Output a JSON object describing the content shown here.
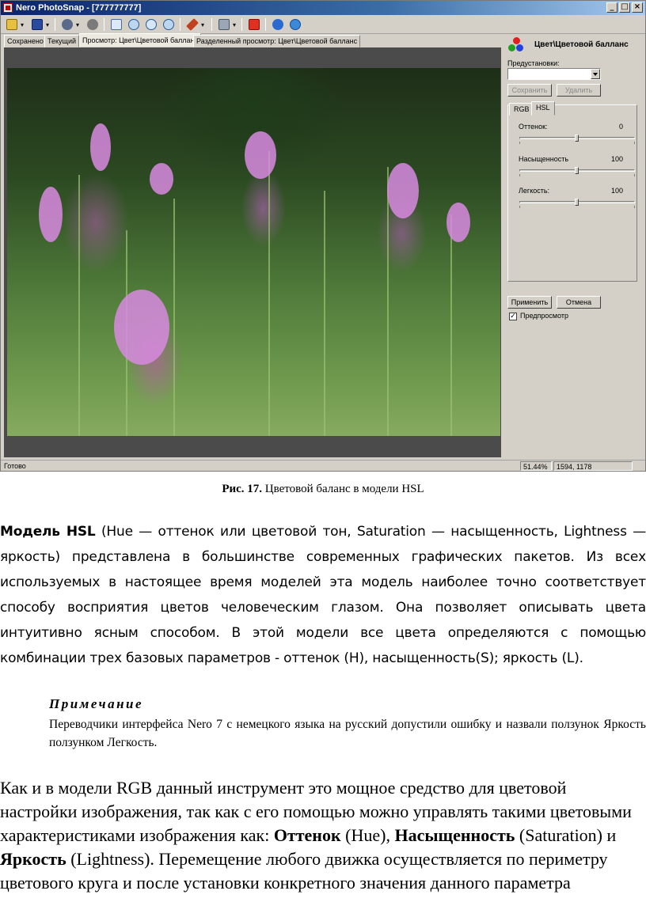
{
  "window": {
    "title": "Nero PhotoSnap - [777777777]",
    "minimize": "_",
    "maximize": "□",
    "close": "×"
  },
  "tabs": [
    {
      "label": "Сохранено"
    },
    {
      "label": "Текущий"
    },
    {
      "label": "Просмотр: Цвет\\Цветовой балланс"
    },
    {
      "label": "Разделенный просмотр: Цвет\\Цветовой балланс"
    }
  ],
  "panel": {
    "title": "Цвет\\Цветовой балланс",
    "presets_label": "Предустановки:",
    "preset_value": "",
    "save_button": "Сохранить",
    "delete_button": "Удалить",
    "tab_rgb": "RGB",
    "tab_hsl": "HSL",
    "sliders": [
      {
        "label": "Оттенок:",
        "value": "0",
        "position": 0.5
      },
      {
        "label": "Насыщенность",
        "value": "100",
        "position": 0.5
      },
      {
        "label": "Легкость:",
        "value": "100",
        "position": 0.5
      }
    ],
    "apply_button": "Применить",
    "cancel_button": "Отмена",
    "preview_checked": "✓",
    "preview_label": "Предпросмотр"
  },
  "status": {
    "text": "Готово",
    "zoom": "51.44%",
    "coords": "1594, 1178"
  },
  "document": {
    "caption_num": "Рис. 17.",
    "caption_text": " Цветовой баланс в модели HSL",
    "p1_bold": "Модель HSL",
    "p1_rest": " (Hue — оттенок или цветовой тон, Saturation — насыщенность, Lightness — яркость) представлена в большинстве современных графических пакетов. Из всех используемых в настоящее время моделей эта модель наиболее точно соответствует способу восприятия цветов человеческим глазом. Она позволяет описывать цвета интуитивно ясным способом. В этой модели все цвета определяются с помощью комбинации трех базовых параметров - оттенок (H), насыщенность(S); яркость (L).",
    "note_title": "Примечание",
    "note_body": "Переводчики интерфейса Nero 7 с немецкого языка на русский допустили ошибку и назвали ползунок Яркость ползунком Легкость.",
    "p2_a": "Как и в модели RGB данный инструмент это мощное средство для цветовой настройки изображения, так как с его помощью можно управлять такими цветовыми характеристиками изображения как: ",
    "p2_hue": "Оттенок",
    "p2_b": " (Hue), ",
    "p2_sat": "Насыщенность",
    "p2_c": " (Saturation) и ",
    "p2_light": "Яркость",
    "p2_d": " (Lightness). Перемещение любого движка осуществляется по периметру цветового круга и после установки конкретного значения данного параметра"
  }
}
